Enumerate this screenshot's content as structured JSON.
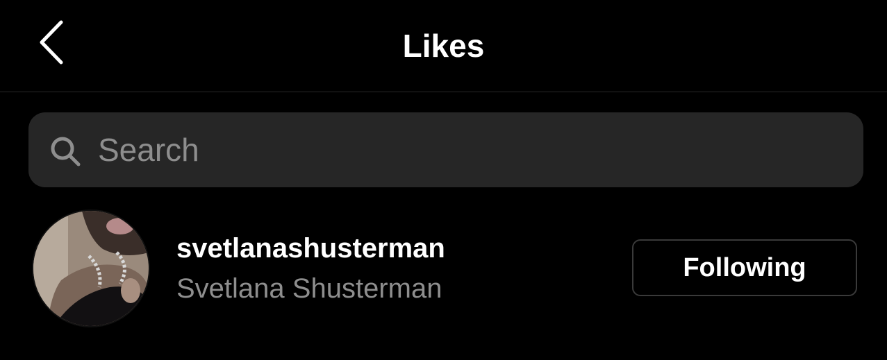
{
  "header": {
    "title": "Likes",
    "back_icon": "chevron-left-icon"
  },
  "search": {
    "placeholder": "Search",
    "value": "",
    "icon": "search-icon"
  },
  "likes": [
    {
      "username": "svetlanashusterman",
      "full_name": "Svetlana Shusterman",
      "button_label": "Following"
    }
  ],
  "colors": {
    "background": "#000000",
    "search_bg": "#262626",
    "secondary_text": "#8e8e8e",
    "button_border": "#3a3a3a"
  }
}
